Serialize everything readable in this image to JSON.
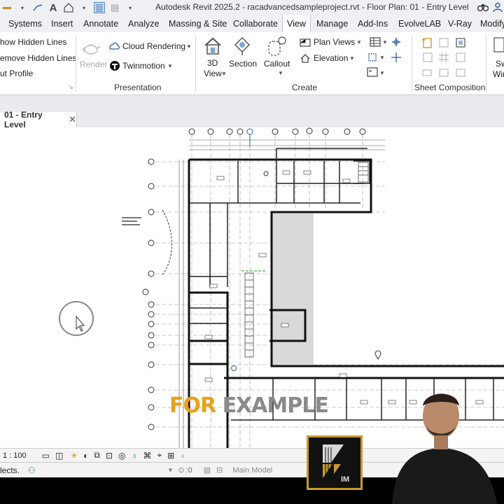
{
  "titlebar": {
    "title": "Autodesk Revit 2025.2 - racadvancedsampleproject.rvt - Floor Plan: 01 - Entry Level",
    "icons": [
      "save-icon",
      "measure-icon",
      "text-a-icon",
      "home-icon",
      "thin-lines-icon",
      "print-icon"
    ]
  },
  "menu": {
    "tabs": [
      "Systems",
      "Insert",
      "Annotate",
      "Analyze",
      "Massing & Site",
      "Collaborate",
      "View",
      "Manage",
      "Add-Ins",
      "EvolveLAB",
      "V-Ray",
      "Modify"
    ],
    "active": "View"
  },
  "ribbon": {
    "graphics": {
      "show_hidden_lines": "how  Hidden Lines",
      "remove_hidden_lines": "emove  Hidden Lines",
      "cut_profile": "ut  Profile"
    },
    "presentation": {
      "render": "Render",
      "cloud_rendering": "Cloud  Rendering",
      "twinmotion": "Twinmotion",
      "title": "Presentation"
    },
    "create": {
      "view_3d_line1": "3D",
      "view_3d_line2": "View",
      "section": "Section",
      "callout": "Callout",
      "plan_views": "Plan  Views",
      "elevation": "Elevation",
      "title": "Create"
    },
    "sheet": {
      "title": "Sheet Composition"
    },
    "windows": {
      "switch_line1": "Sw",
      "switch_line2": "Wir"
    }
  },
  "view_tab": {
    "label": "01 - Entry Level",
    "close": "✕"
  },
  "view_bar": {
    "scale": "1 : 100"
  },
  "status_bar": {
    "left_text": "lects.",
    "filter_count": ":0",
    "model": "Main Model"
  },
  "overlay": {
    "caption_part1": "FOR",
    "caption_part2": "EXAMPLE",
    "logo_text": "IM"
  }
}
